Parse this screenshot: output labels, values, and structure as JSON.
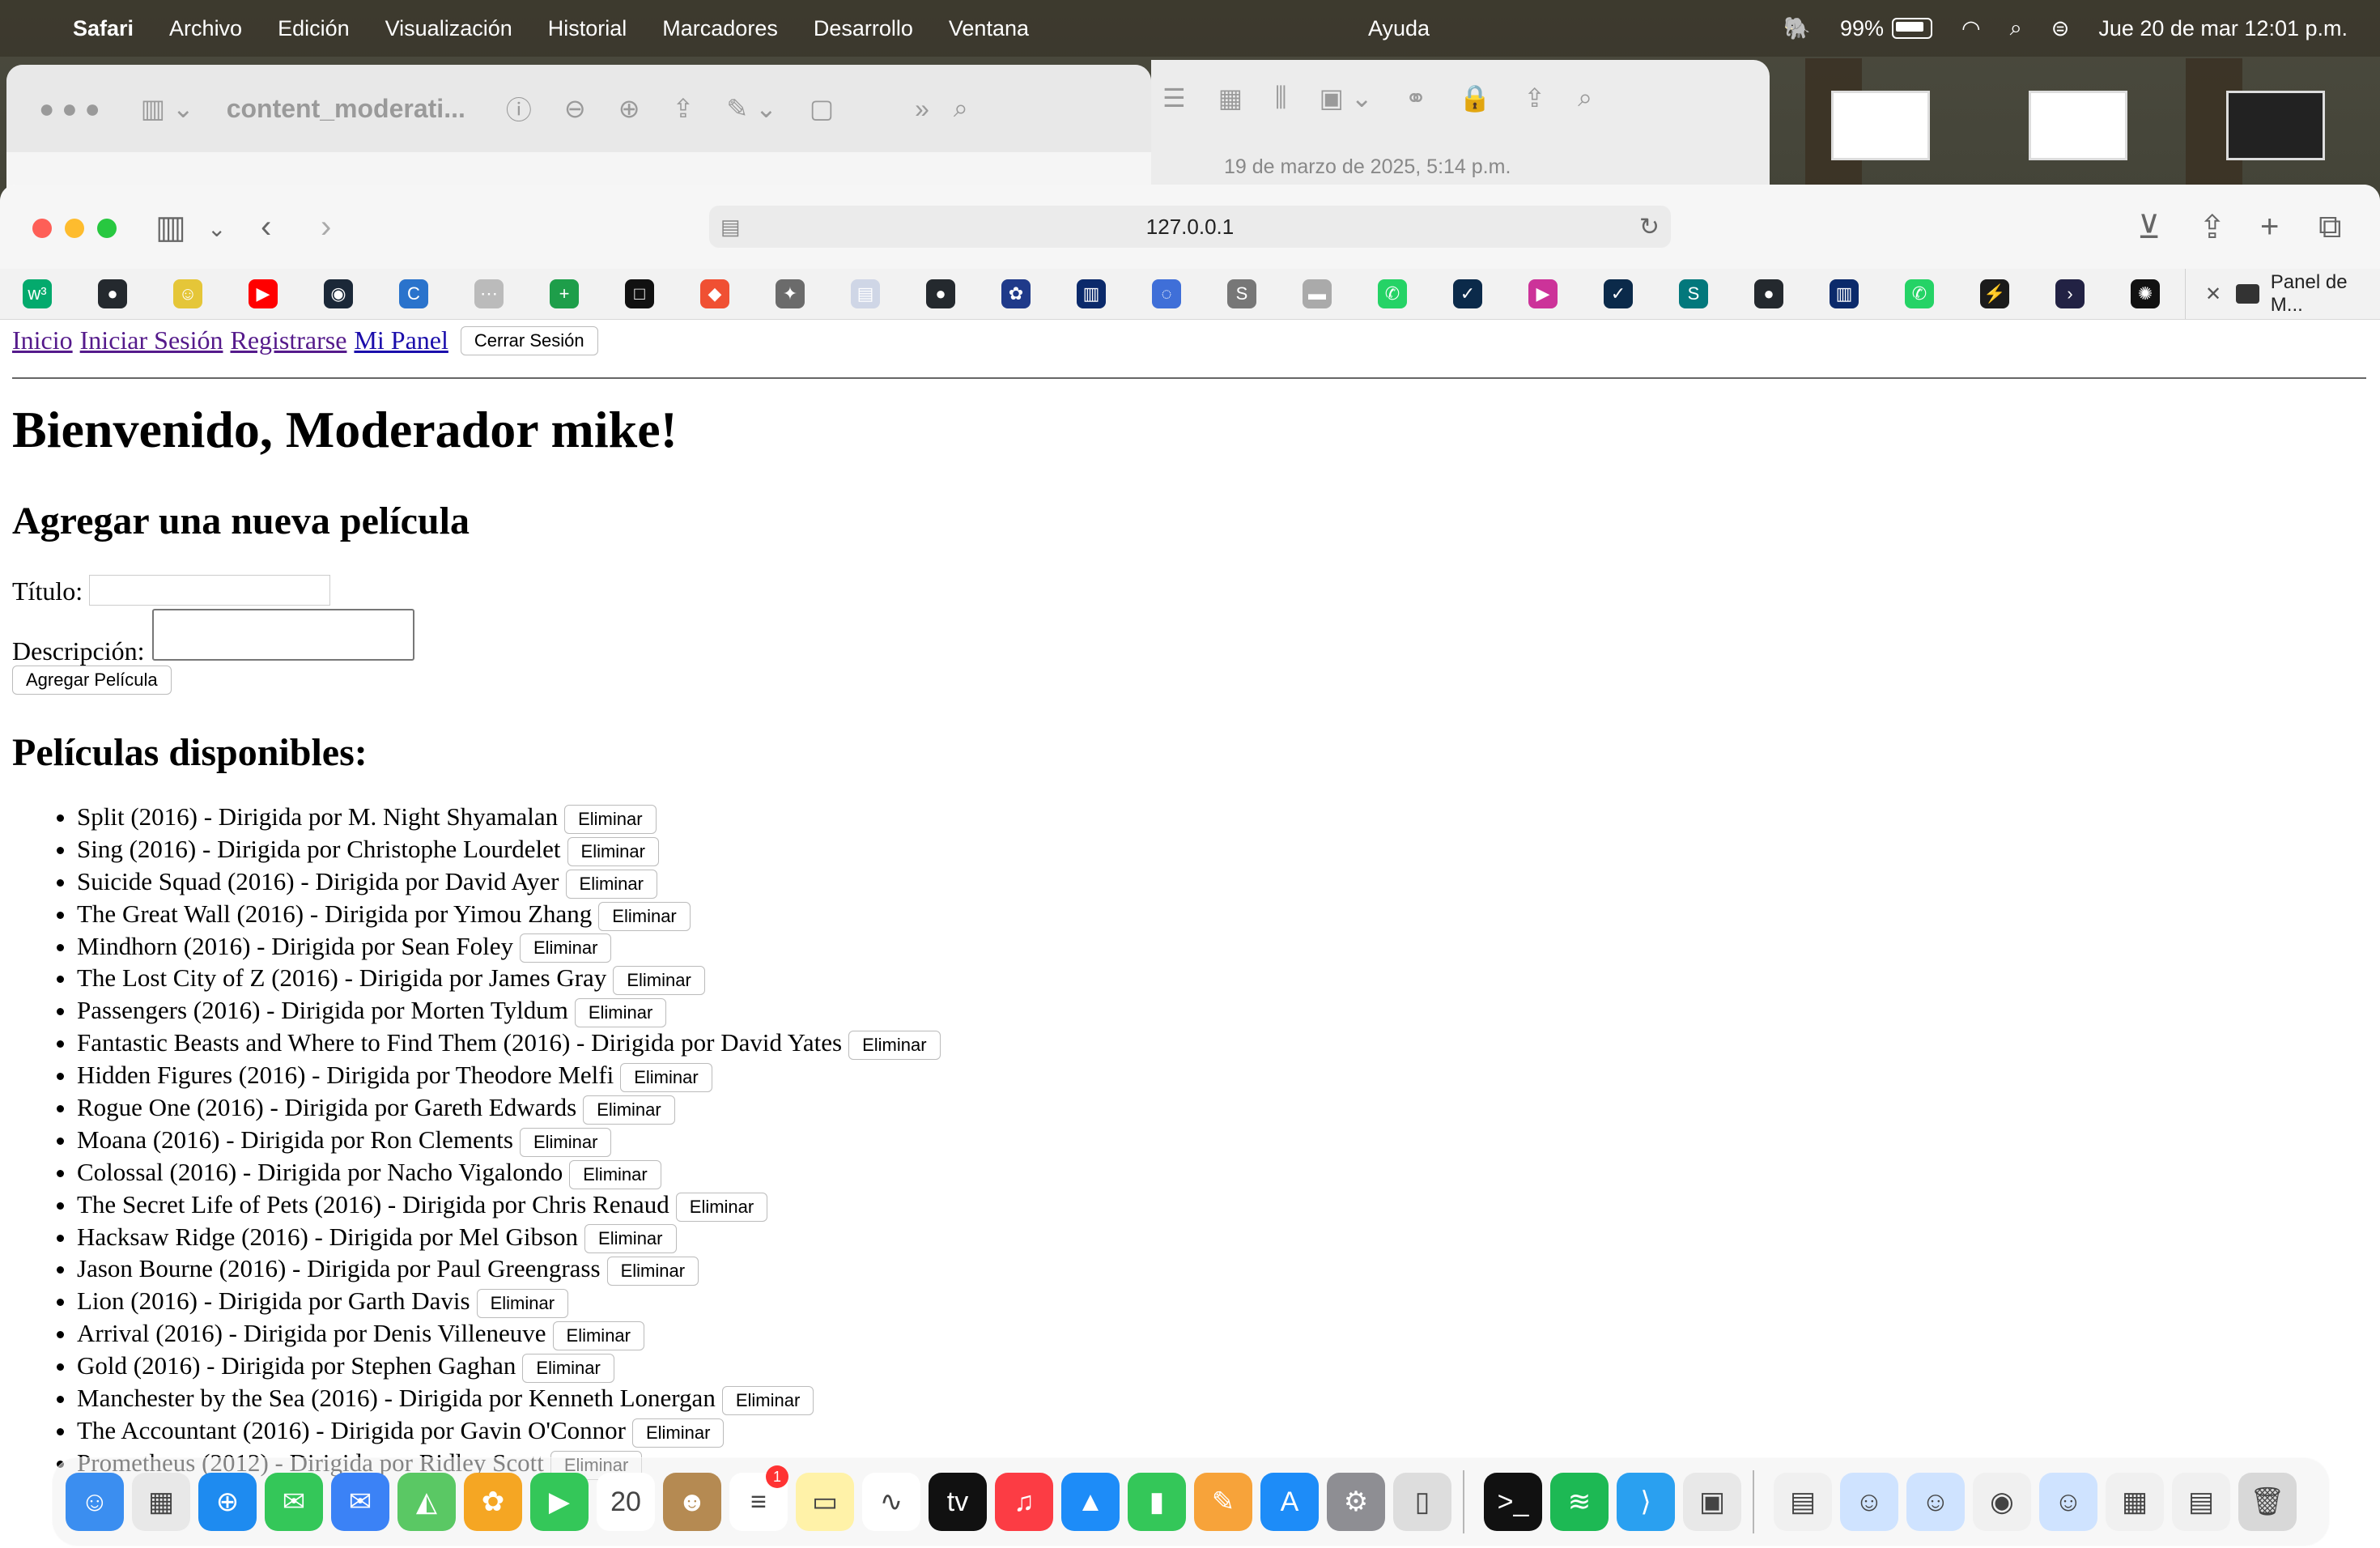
{
  "menubar": {
    "app": "Safari",
    "items": [
      "Archivo",
      "Edición",
      "Visualización",
      "Historial",
      "Marcadores",
      "Desarrollo",
      "Ventana"
    ],
    "help": "Ayuda",
    "battery": "99%",
    "datetime": "Jue 20 de mar  12:01 p.m."
  },
  "bg_window": {
    "title": "content_moderati...",
    "date": "19 de marzo de 2025, 5:14 p.m."
  },
  "browser": {
    "url": "127.0.0.1",
    "tab_title": "Panel de M..."
  },
  "nav": {
    "home": "Inicio",
    "login": "Iniciar Sesión",
    "register": "Registrarse",
    "panel": "Mi Panel",
    "logout": "Cerrar Sesión"
  },
  "welcome": "Bienvenido, Moderador mike!",
  "add_form": {
    "heading": "Agregar una nueva película",
    "title_label": "Título:",
    "description_label": "Descripción:",
    "submit": "Agregar Película"
  },
  "movies_heading": "Películas disponibles:",
  "delete_label": "Eliminar",
  "movies": [
    "Split (2016) - Dirigida por M. Night Shyamalan",
    "Sing (2016) - Dirigida por Christophe Lourdelet",
    "Suicide Squad (2016) - Dirigida por David Ayer",
    "The Great Wall (2016) - Dirigida por Yimou Zhang",
    "Mindhorn (2016) - Dirigida por Sean Foley",
    "The Lost City of Z (2016) - Dirigida por James Gray",
    "Passengers (2016) - Dirigida por Morten Tyldum",
    "Fantastic Beasts and Where to Find Them (2016) - Dirigida por David Yates",
    "Hidden Figures (2016) - Dirigida por Theodore Melfi",
    "Rogue One (2016) - Dirigida por Gareth Edwards",
    "Moana (2016) - Dirigida por Ron Clements",
    "Colossal (2016) - Dirigida por Nacho Vigalondo",
    "The Secret Life of Pets (2016) - Dirigida por Chris Renaud",
    "Hacksaw Ridge (2016) - Dirigida por Mel Gibson",
    "Jason Bourne (2016) - Dirigida por Paul Greengrass",
    "Lion (2016) - Dirigida por Garth Davis",
    "Arrival (2016) - Dirigida por Denis Villeneuve",
    "Gold (2016) - Dirigida por Stephen Gaghan",
    "Manchester by the Sea (2016) - Dirigida por Kenneth Lonergan",
    "The Accountant (2016) - Dirigida por Gavin O'Connor",
    "Prometheus (2012) - Dirigida por Ridley Scott"
  ],
  "favorites": [
    {
      "icon": "w3schools-icon",
      "color": "#04aa6d",
      "glyph": "w³"
    },
    {
      "icon": "github-icon",
      "color": "#24292e",
      "glyph": "●"
    },
    {
      "icon": "mascot-icon",
      "color": "#e5c638",
      "glyph": "☺"
    },
    {
      "icon": "youtube-icon",
      "color": "#ff0000",
      "glyph": "▶"
    },
    {
      "icon": "steam-icon",
      "color": "#1b2838",
      "glyph": "◉"
    },
    {
      "icon": "coursera-icon",
      "color": "#2a73cc",
      "glyph": "C"
    },
    {
      "icon": "dots-icon",
      "color": "#bbbbbb",
      "glyph": "⋯"
    },
    {
      "icon": "sheets-icon",
      "color": "#1e9e4a",
      "glyph": "+"
    },
    {
      "icon": "notion-icon",
      "color": "#111111",
      "glyph": "□"
    },
    {
      "icon": "git-icon",
      "color": "#f05033",
      "glyph": "◆"
    },
    {
      "icon": "bird-icon",
      "color": "#6b6b6b",
      "glyph": "✦"
    },
    {
      "icon": "doc-icon",
      "color": "#cfd6e6",
      "glyph": "▤"
    },
    {
      "icon": "github-icon",
      "color": "#24292e",
      "glyph": "●"
    },
    {
      "icon": "paw-icon",
      "color": "#1f3a8a",
      "glyph": "✿"
    },
    {
      "icon": "university-icon",
      "color": "#0b2a6b",
      "glyph": "▥"
    },
    {
      "icon": "fish-icon",
      "color": "#3f6fd8",
      "glyph": "◌"
    },
    {
      "icon": "s-icon",
      "color": "#777777",
      "glyph": "S"
    },
    {
      "icon": "banner-icon",
      "color": "#aaaaaa",
      "glyph": "▬"
    },
    {
      "icon": "whatsapp-icon",
      "color": "#25d366",
      "glyph": "✆"
    },
    {
      "icon": "check-icon",
      "color": "#0b2a4a",
      "glyph": "✓"
    },
    {
      "icon": "play-icon",
      "color": "#cc3399",
      "glyph": "▶"
    },
    {
      "icon": "check-icon",
      "color": "#0b2a4a",
      "glyph": "✓"
    },
    {
      "icon": "sharepoint-icon",
      "color": "#03787c",
      "glyph": "S"
    },
    {
      "icon": "github-icon",
      "color": "#24292e",
      "glyph": "●"
    },
    {
      "icon": "university-icon",
      "color": "#0b2a6b",
      "glyph": "▥"
    },
    {
      "icon": "whatsapp-icon",
      "color": "#25d366",
      "glyph": "✆"
    },
    {
      "icon": "bolt-icon",
      "color": "#1b1b1b",
      "glyph": "⚡"
    },
    {
      "icon": "terminal-icon",
      "color": "#222244",
      "glyph": "›"
    },
    {
      "icon": "openai-icon",
      "color": "#111111",
      "glyph": "✺"
    }
  ],
  "dock": [
    {
      "icon": "finder-icon",
      "color": "#3b8ef0",
      "glyph": "☺"
    },
    {
      "icon": "launchpad-icon",
      "color": "#e8e8e8",
      "glyph": "▦"
    },
    {
      "icon": "safari-icon",
      "color": "#1e8bf0",
      "glyph": "⊕"
    },
    {
      "icon": "messages-icon",
      "color": "#34c759",
      "glyph": "✉"
    },
    {
      "icon": "mail-icon",
      "color": "#3b82f6",
      "glyph": "✉"
    },
    {
      "icon": "maps-icon",
      "color": "#5ac864",
      "glyph": "◭"
    },
    {
      "icon": "photos-icon",
      "color": "#f5a623",
      "glyph": "✿"
    },
    {
      "icon": "facetime-icon",
      "color": "#34c759",
      "glyph": "▶"
    },
    {
      "icon": "calendar-icon",
      "color": "#ffffff",
      "glyph": "20"
    },
    {
      "icon": "contacts-icon",
      "color": "#b58a52",
      "glyph": "☻"
    },
    {
      "icon": "reminders-icon",
      "color": "#ffffff",
      "glyph": "≡"
    },
    {
      "icon": "notes-icon",
      "color": "#fff2a8",
      "glyph": "▭"
    },
    {
      "icon": "freeform-icon",
      "color": "#ffffff",
      "glyph": "∿"
    },
    {
      "icon": "tv-icon",
      "color": "#111111",
      "glyph": "tv"
    },
    {
      "icon": "music-icon",
      "color": "#fc3c44",
      "glyph": "♫"
    },
    {
      "icon": "keynote-icon",
      "color": "#1d8cf8",
      "glyph": "▲"
    },
    {
      "icon": "numbers-icon",
      "color": "#34c759",
      "glyph": "▮"
    },
    {
      "icon": "pages-icon",
      "color": "#f7a33a",
      "glyph": "✎"
    },
    {
      "icon": "appstore-icon",
      "color": "#1d8cf8",
      "glyph": "A"
    },
    {
      "icon": "settings-icon",
      "color": "#8e8e93",
      "glyph": "⚙"
    },
    {
      "icon": "iphone-mirroring-icon",
      "color": "#dddddd",
      "glyph": "▯"
    },
    {
      "icon": "terminal-icon",
      "color": "#111111",
      "glyph": ">_"
    },
    {
      "icon": "spotify-icon",
      "color": "#1db954",
      "glyph": "≋"
    },
    {
      "icon": "vscode-icon",
      "color": "#2aa0f0",
      "glyph": "⟩"
    },
    {
      "icon": "preview-icon",
      "color": "#e8e8e8",
      "glyph": "▣"
    },
    {
      "icon": "document-icon",
      "color": "#f0f0f0",
      "glyph": "▤"
    },
    {
      "icon": "finder-mini-icon",
      "color": "#cfe3ff",
      "glyph": "☺"
    },
    {
      "icon": "finder-mini-icon",
      "color": "#cfe3ff",
      "glyph": "☺"
    },
    {
      "icon": "chrome-mini-icon",
      "color": "#f0f0f0",
      "glyph": "◉"
    },
    {
      "icon": "finder-mini-icon",
      "color": "#cfe3ff",
      "glyph": "☺"
    },
    {
      "icon": "numbers-doc-icon",
      "color": "#f0f0f0",
      "glyph": "▦"
    },
    {
      "icon": "doc-stack-icon",
      "color": "#f0f0f0",
      "glyph": "▤"
    },
    {
      "icon": "trash-icon",
      "color": "#d8d8d8",
      "glyph": "🗑"
    }
  ],
  "dock_badge": "1"
}
